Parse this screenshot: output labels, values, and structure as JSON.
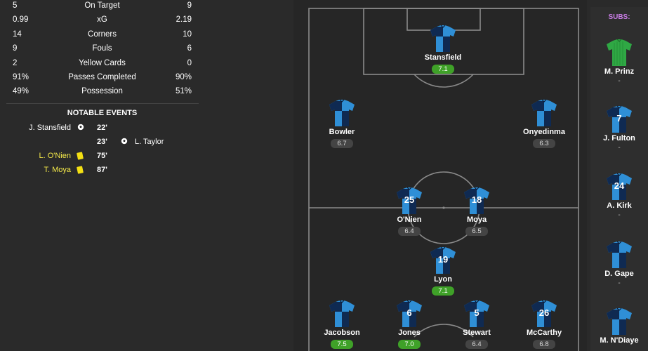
{
  "stats": [
    {
      "home": "5",
      "label": "On Target",
      "away": "9"
    },
    {
      "home": "0.99",
      "label": "xG",
      "away": "2.19"
    },
    {
      "home": "14",
      "label": "Corners",
      "away": "10"
    },
    {
      "home": "9",
      "label": "Fouls",
      "away": "6"
    },
    {
      "home": "2",
      "label": "Yellow Cards",
      "away": "0"
    },
    {
      "home": "91%",
      "label": "Passes Completed",
      "away": "90%"
    },
    {
      "home": "49%",
      "label": "Possession",
      "away": "51%"
    }
  ],
  "events_title": "NOTABLE EVENTS",
  "events": [
    {
      "home_player": "J. Stansfield",
      "icon": "goal-icon",
      "minute": "22'",
      "away_player": ""
    },
    {
      "home_player": "",
      "icon": "",
      "minute": "23'",
      "away_player": "L. Taylor",
      "away_icon": "goal-icon"
    },
    {
      "home_player": "L. O'Nien",
      "icon": "yellow-card-icon",
      "minute": "75'",
      "away_player": ""
    },
    {
      "home_player": "T. Moya",
      "icon": "yellow-card-icon",
      "minute": "87'",
      "away_player": ""
    }
  ],
  "players": [
    {
      "name": "Stansfield",
      "number": "",
      "rating": "7.1",
      "good": true
    },
    {
      "name": "Bowler",
      "number": "",
      "rating": "6.7",
      "good": false
    },
    {
      "name": "Onyedinma",
      "number": "",
      "rating": "6.3",
      "good": false
    },
    {
      "name": "O'Nien",
      "number": "25",
      "rating": "6.4",
      "good": false
    },
    {
      "name": "Moya",
      "number": "18",
      "rating": "6.5",
      "good": false
    },
    {
      "name": "Lyon",
      "number": "19",
      "rating": "7.1",
      "good": true
    },
    {
      "name": "Jacobson",
      "number": "",
      "rating": "7.5",
      "good": true
    },
    {
      "name": "Jones",
      "number": "6",
      "rating": "7.0",
      "good": true
    },
    {
      "name": "Stewart",
      "number": "5",
      "rating": "6.4",
      "good": false
    },
    {
      "name": "McCarthy",
      "number": "26",
      "rating": "6.8",
      "good": false
    }
  ],
  "subs_title": "SUBS:",
  "subs": [
    {
      "name": "M. Prinz",
      "number": "",
      "rating": "-",
      "keeper": true
    },
    {
      "name": "J. Fulton",
      "number": "7",
      "rating": "-",
      "keeper": false
    },
    {
      "name": "A. Kirk",
      "number": "24",
      "rating": "-",
      "keeper": false
    },
    {
      "name": "D. Gape",
      "number": "",
      "rating": "-",
      "keeper": false
    },
    {
      "name": "M. N'Diaye",
      "number": "",
      "rating": "",
      "keeper": false
    }
  ],
  "colors": {
    "shirt_light": "#2f8fd6",
    "shirt_dark": "#0f2a52",
    "keeper": "#2fa844",
    "rating_good": "#3fa128",
    "card": "#f4e013",
    "subs_title": "#c97de6"
  }
}
